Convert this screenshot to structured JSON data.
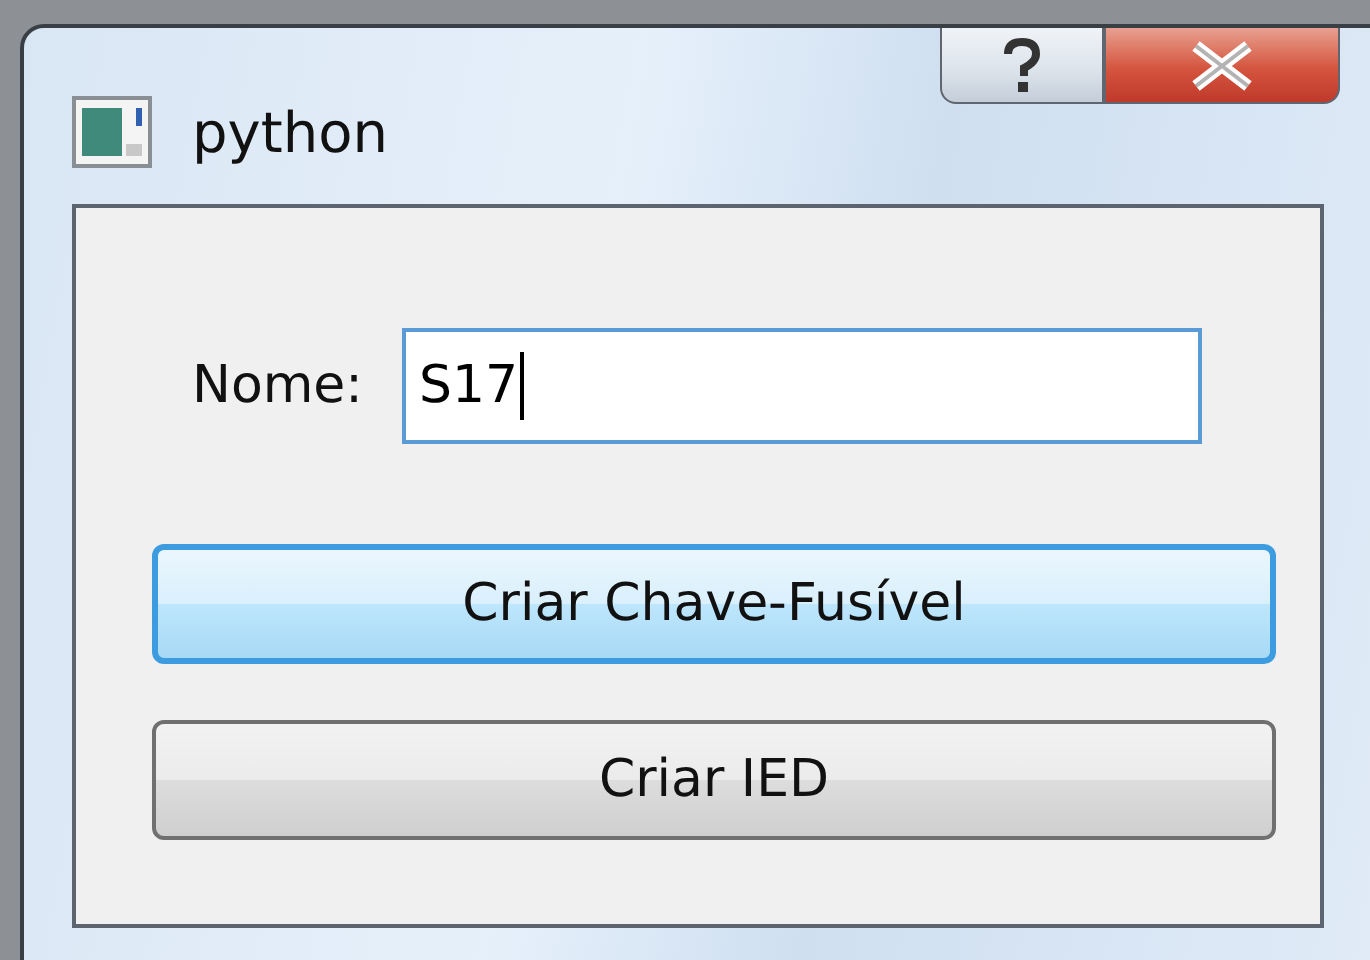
{
  "window": {
    "title": "python"
  },
  "name_field": {
    "label": "Nome:",
    "value": "S17",
    "focused": true
  },
  "buttons": [
    {
      "label": "Criar Chave-Fusível",
      "focused": true
    },
    {
      "label": "Criar IED",
      "focused": false
    }
  ]
}
